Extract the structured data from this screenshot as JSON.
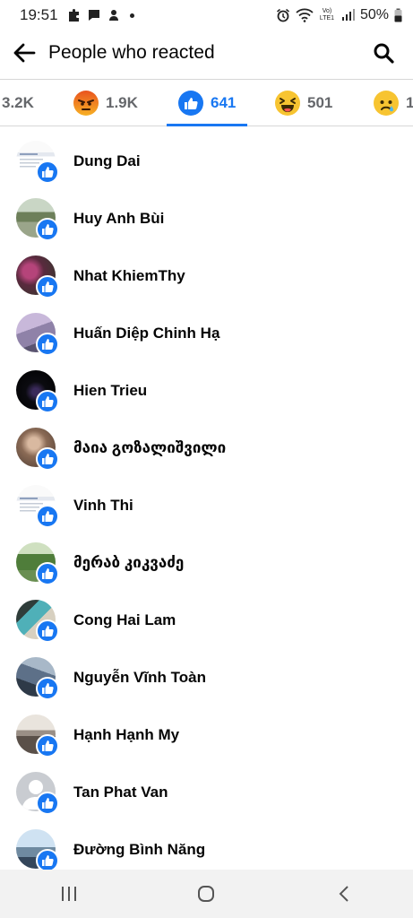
{
  "status_bar": {
    "time": "19:51",
    "battery": "50%",
    "network_label": "Vo) LTE1"
  },
  "header": {
    "title": "People who reacted"
  },
  "tabs": [
    {
      "count": "3.2K",
      "reaction": "all-partial",
      "active": false
    },
    {
      "count": "1.9K",
      "reaction": "angry",
      "active": false
    },
    {
      "count": "641",
      "reaction": "like",
      "active": true
    },
    {
      "count": "501",
      "reaction": "haha",
      "active": false
    },
    {
      "count": "1",
      "reaction": "sad",
      "active": false
    }
  ],
  "people": [
    {
      "name": "Dung Dai",
      "avatar": "screenshot-thumb"
    },
    {
      "name": "Huy Anh Bùi",
      "avatar": "outdoor-photo"
    },
    {
      "name": "Nhat KhiemThy",
      "avatar": "flowers-photo"
    },
    {
      "name": "Huấn Diệp Chinh Hạ",
      "avatar": "purple-photo"
    },
    {
      "name": "Hien Trieu",
      "avatar": "dark-photo"
    },
    {
      "name": "მაია გოზალიშვილი",
      "avatar": "portrait-photo"
    },
    {
      "name": "Vinh Thi",
      "avatar": "screenshot-thumb"
    },
    {
      "name": "მერაბ კიკვაძე",
      "avatar": "green-photo"
    },
    {
      "name": "Cong Hai Lam",
      "avatar": "group-photo"
    },
    {
      "name": "Nguyễn Vĩnh Toàn",
      "avatar": "blue-photo"
    },
    {
      "name": "Hạnh Hạnh My",
      "avatar": "beach-photo"
    },
    {
      "name": "Tan Phat Van",
      "avatar": "default-silhouette"
    },
    {
      "name": "Đường Bình Năng",
      "avatar": "sky-photo"
    }
  ],
  "colors": {
    "accent": "#1877f2",
    "text": "#050505",
    "muted": "#65676b"
  }
}
